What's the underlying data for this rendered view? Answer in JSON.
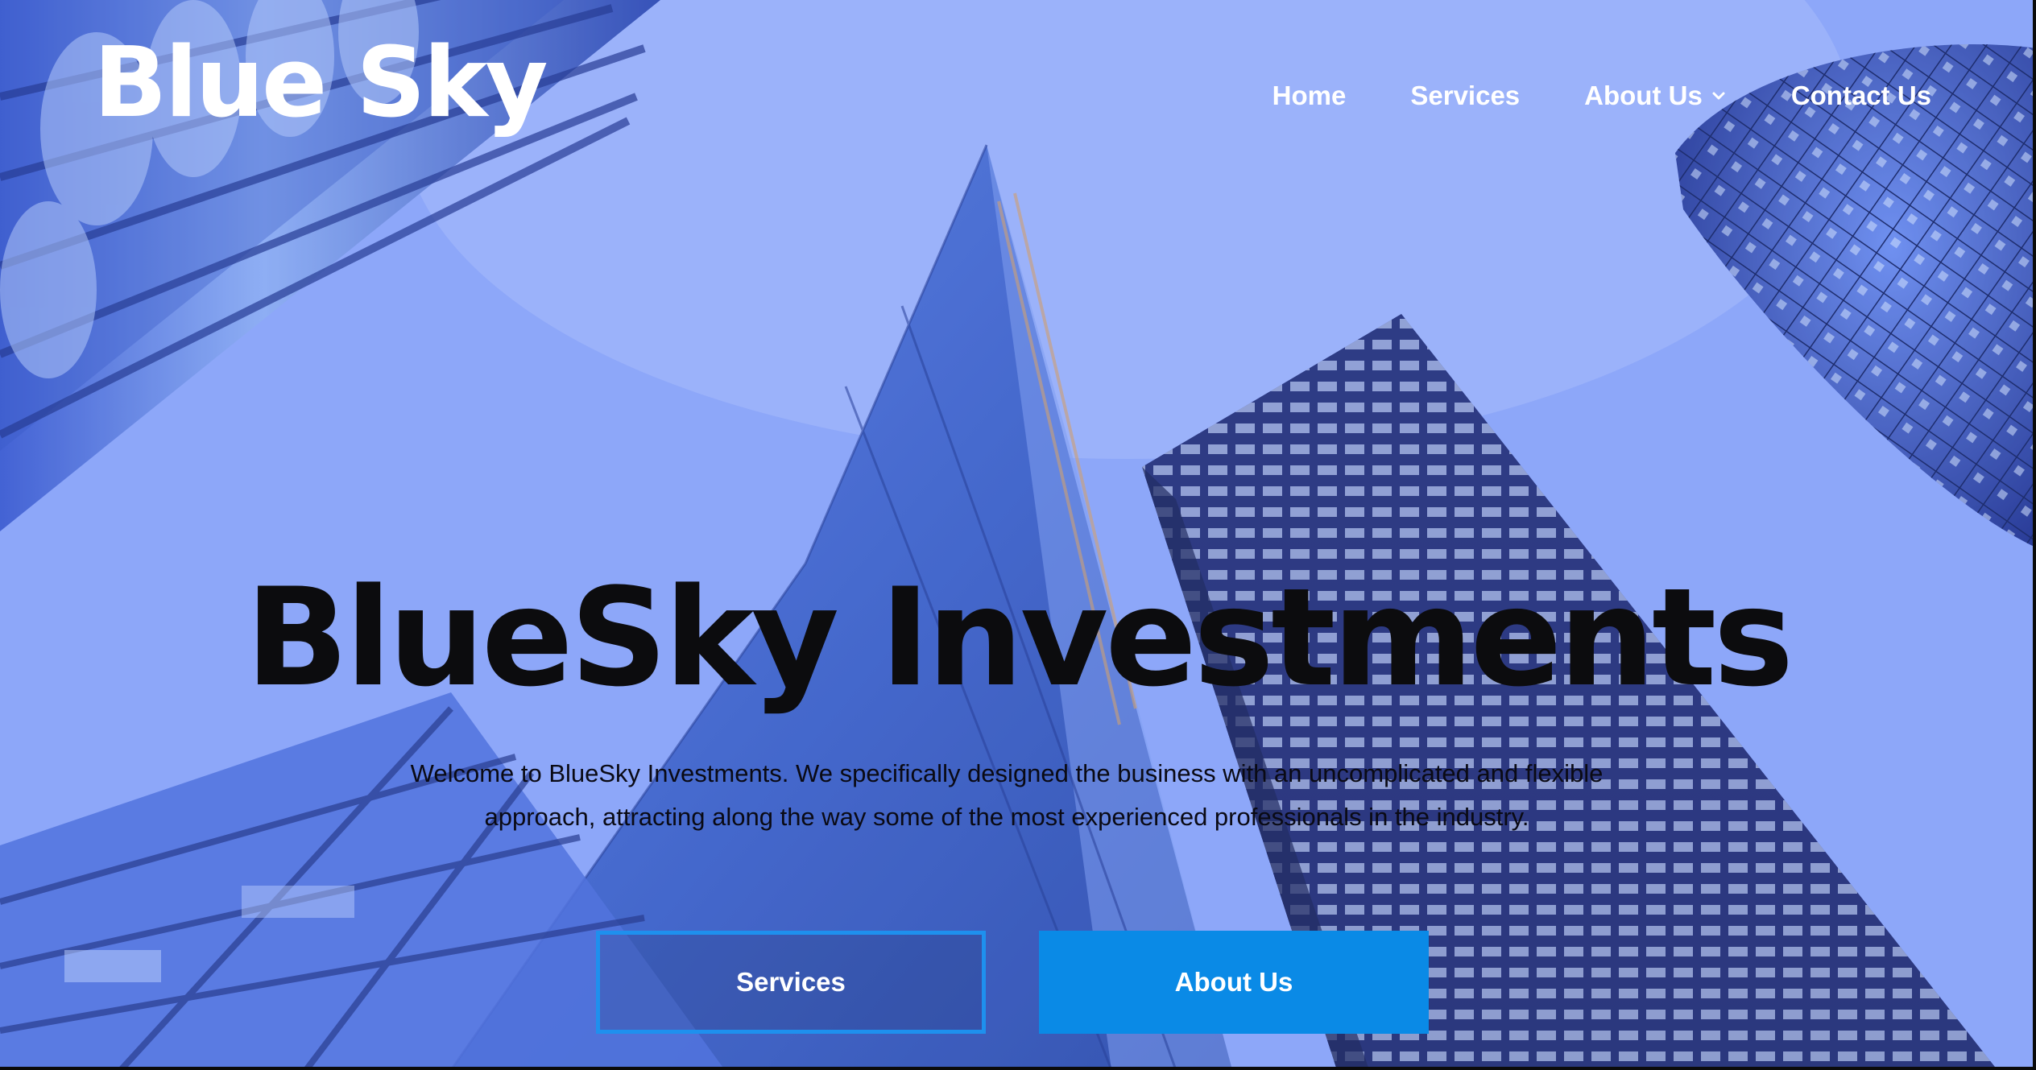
{
  "header": {
    "logo": "Blue Sky",
    "nav": [
      {
        "label": "Home"
      },
      {
        "label": "Services"
      },
      {
        "label": "About Us",
        "has_dropdown": true
      },
      {
        "label": "Contact Us"
      }
    ]
  },
  "hero": {
    "title": "BlueSky Investments",
    "intro": "Welcome to BlueSky Investments. We specifically designed the business with an uncomplicated and flexible approach, attracting along the way some of the most experienced professionals in the industry.",
    "buttons": {
      "services_label": "Services",
      "about_label": "About Us"
    }
  },
  "icons": {
    "dropdown": "chevron-down-icon"
  },
  "colors": {
    "sky": "#8aa5fa",
    "title": "#0c0c0e",
    "button_fill": "#0a8ae6",
    "button_outline": "#1e90ee",
    "nav_text": "#ffffff"
  }
}
